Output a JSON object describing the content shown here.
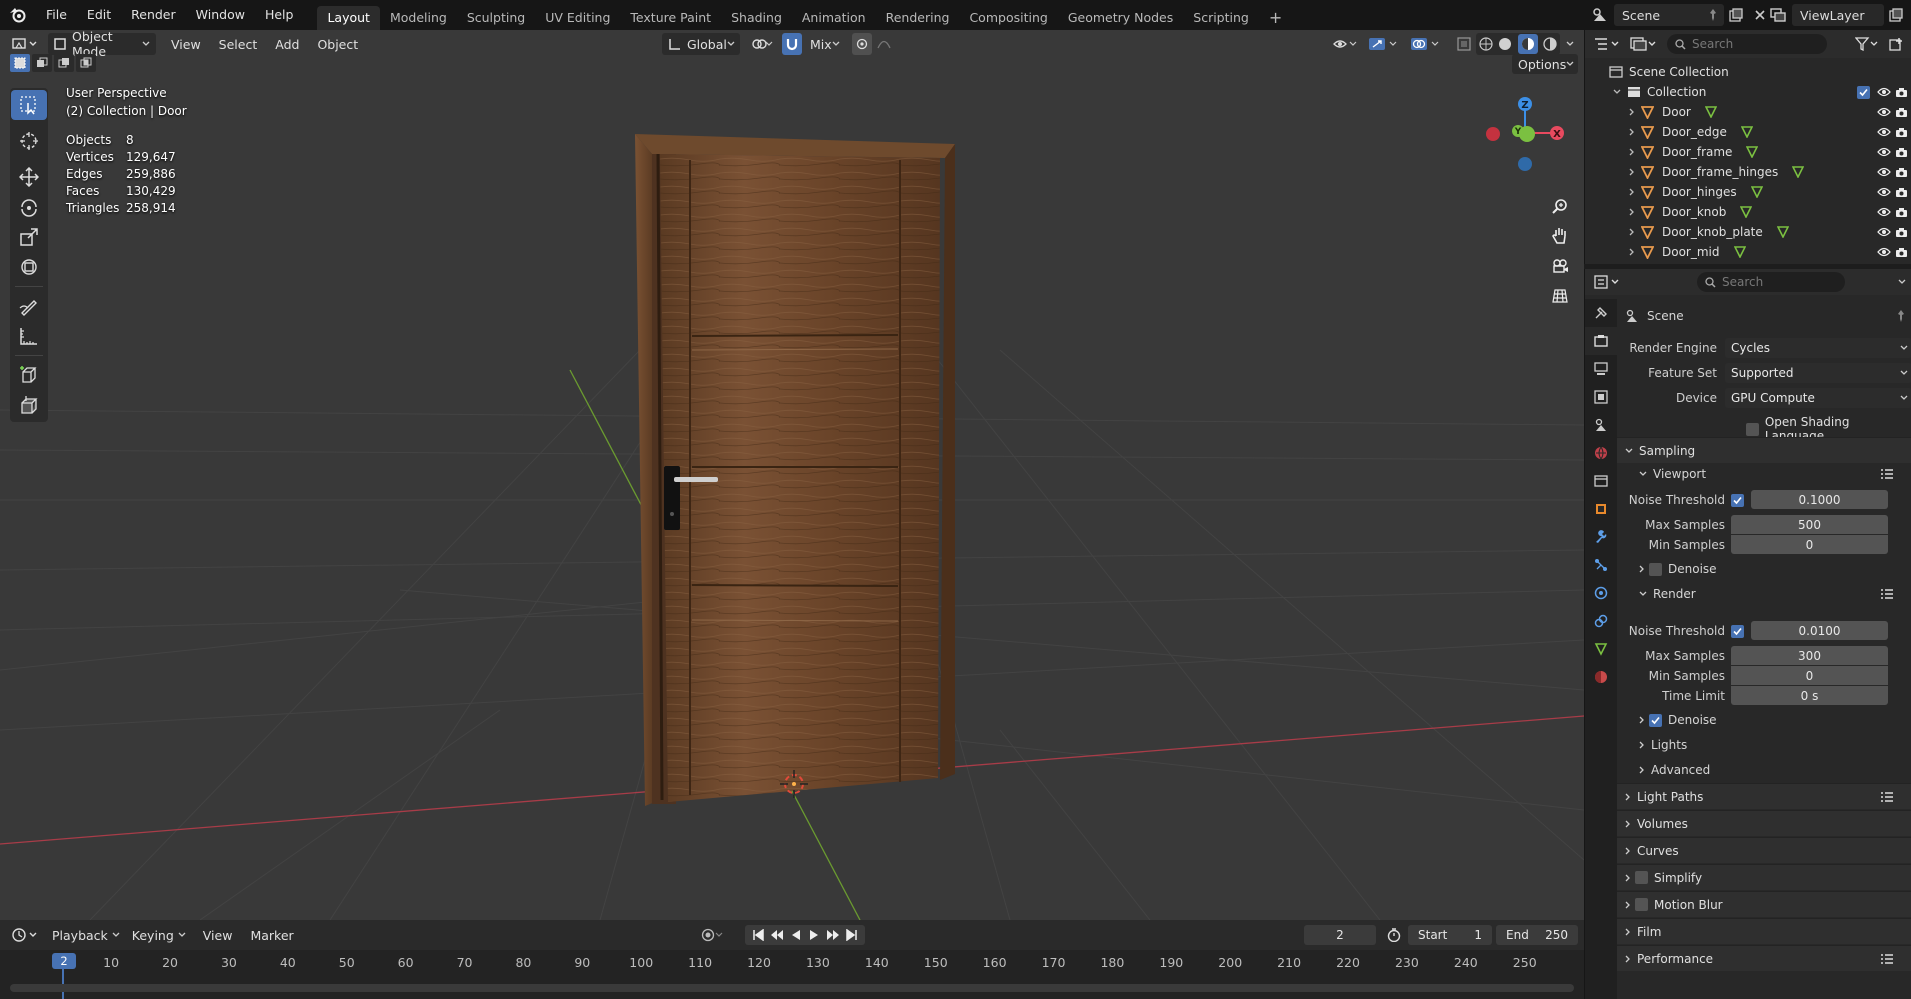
{
  "topbar": {
    "menus": [
      "File",
      "Edit",
      "Render",
      "Window",
      "Help"
    ],
    "workspaces": [
      "Layout",
      "Modeling",
      "Sculpting",
      "UV Editing",
      "Texture Paint",
      "Shading",
      "Animation",
      "Rendering",
      "Compositing",
      "Geometry Nodes",
      "Scripting"
    ],
    "active_workspace": "Layout",
    "scene": "Scene",
    "view_layer": "ViewLayer"
  },
  "viewport": {
    "header": {
      "mode": "Object Mode",
      "menus": [
        "View",
        "Select",
        "Add",
        "Object"
      ],
      "orientation": "Global",
      "snap_mode": "Mix",
      "options": "Options"
    },
    "overlay": {
      "perspective": "User Perspective",
      "collection": "(2) Collection | Door"
    },
    "stats": [
      {
        "key": "Objects",
        "value": "8"
      },
      {
        "key": "Vertices",
        "value": "129,647"
      },
      {
        "key": "Edges",
        "value": "259,886"
      },
      {
        "key": "Faces",
        "value": "130,429"
      },
      {
        "key": "Triangles",
        "value": "258,914"
      }
    ],
    "gizmo_labels": {
      "z": "Z",
      "y": "Y",
      "x": "X"
    }
  },
  "timeline": {
    "menus": [
      "Playback",
      "Keying",
      "View",
      "Marker"
    ],
    "current_frame": "2",
    "start_label": "Start",
    "start": "1",
    "end_label": "End",
    "end": "250",
    "ruler": [
      "2",
      "10",
      "20",
      "30",
      "40",
      "50",
      "60",
      "70",
      "80",
      "90",
      "100",
      "110",
      "120",
      "130",
      "140",
      "150",
      "160",
      "170",
      "180",
      "190",
      "200",
      "210",
      "220",
      "230",
      "240",
      "250"
    ]
  },
  "outliner": {
    "search_placeholder": "Search",
    "scene_collection": "Scene Collection",
    "collection": "Collection",
    "objects": [
      "Door",
      "Door_edge",
      "Door_frame",
      "Door_frame_hinges",
      "Door_hinges",
      "Door_knob",
      "Door_knob_plate",
      "Door_mid"
    ]
  },
  "properties": {
    "search_placeholder": "Search",
    "context": "Scene",
    "render_engine_label": "Render Engine",
    "render_engine": "Cycles",
    "feature_set_label": "Feature Set",
    "feature_set": "Supported",
    "device_label": "Device",
    "device": "GPU Compute",
    "osl_label": "Open Shading Language",
    "sampling": "Sampling",
    "viewport": "Viewport",
    "noise_threshold_label": "Noise Threshold",
    "vp_noise_threshold": "0.1000",
    "max_samples_label": "Max Samples",
    "vp_max_samples": "500",
    "min_samples_label": "Min Samples",
    "vp_min_samples": "0",
    "denoise_label": "Denoise",
    "render": "Render",
    "r_noise_threshold": "0.0100",
    "r_max_samples": "300",
    "r_min_samples": "0",
    "time_limit_label": "Time Limit",
    "r_time_limit": "0 s",
    "lights": "Lights",
    "advanced": "Advanced",
    "light_paths": "Light Paths",
    "volumes": "Volumes",
    "curves": "Curves",
    "simplify": "Simplify",
    "motion_blur": "Motion Blur",
    "film": "Film",
    "performance": "Performance"
  },
  "colors": {
    "accent": "#4772b3",
    "x_axis": "#e84a5f",
    "y_axis": "#7bc041",
    "z_axis": "#3c8fe6",
    "mesh_icon": "#e89a4e"
  }
}
